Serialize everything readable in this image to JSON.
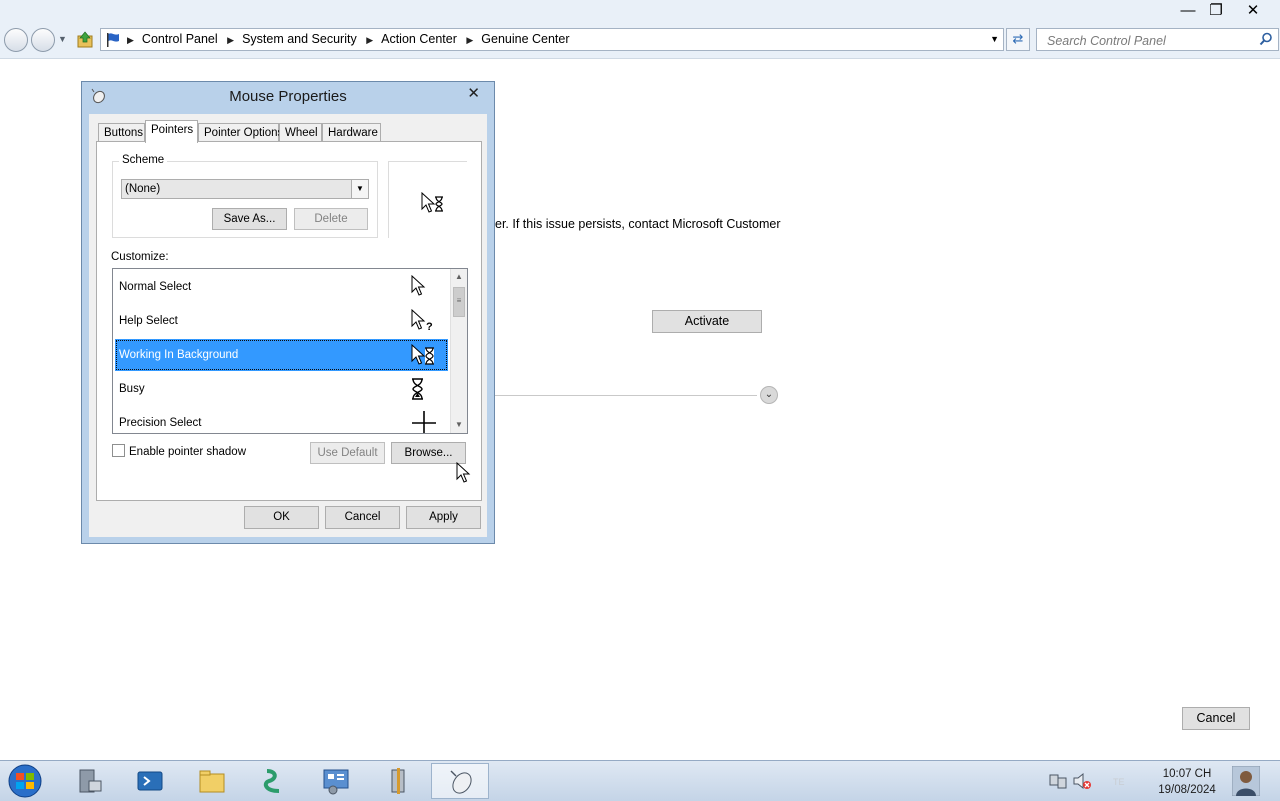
{
  "explorer": {
    "breadcrumbs": [
      "Control Panel",
      "System and Security",
      "Action Center",
      "Genuine Center"
    ],
    "search_placeholder": "Search Control Panel"
  },
  "page": {
    "message_fragment": "er. If this issue persists, contact Microsoft Customer",
    "activate_label": "Activate",
    "cancel_label": "Cancel"
  },
  "dialog": {
    "title": "Mouse Properties",
    "tabs": [
      "Buttons",
      "Pointers",
      "Pointer Options",
      "Wheel",
      "Hardware"
    ],
    "active_tab": "Pointers",
    "scheme": {
      "legend": "Scheme",
      "selected": "(None)",
      "save_as_label": "Save As...",
      "delete_label": "Delete"
    },
    "customize_label": "Customize:",
    "pointers": [
      {
        "name": "Normal Select",
        "icon": "arrow-cursor-icon"
      },
      {
        "name": "Help Select",
        "icon": "help-cursor-icon"
      },
      {
        "name": "Working In Background",
        "icon": "working-cursor-icon",
        "selected": true
      },
      {
        "name": "Busy",
        "icon": "hourglass-cursor-icon"
      },
      {
        "name": "Precision Select",
        "icon": "crosshair-cursor-icon"
      }
    ],
    "enable_shadow_label": "Enable pointer shadow",
    "use_default_label": "Use Default",
    "browse_label": "Browse...",
    "ok_label": "OK",
    "cancel_label": "Cancel",
    "apply_label": "Apply"
  },
  "taskbar": {
    "time": "10:07 CH",
    "date": "19/08/2024"
  },
  "colors": {
    "selection": "#3399ff",
    "dialog_frame": "#b9d1ea",
    "taskbar": "#c4d4e7"
  }
}
